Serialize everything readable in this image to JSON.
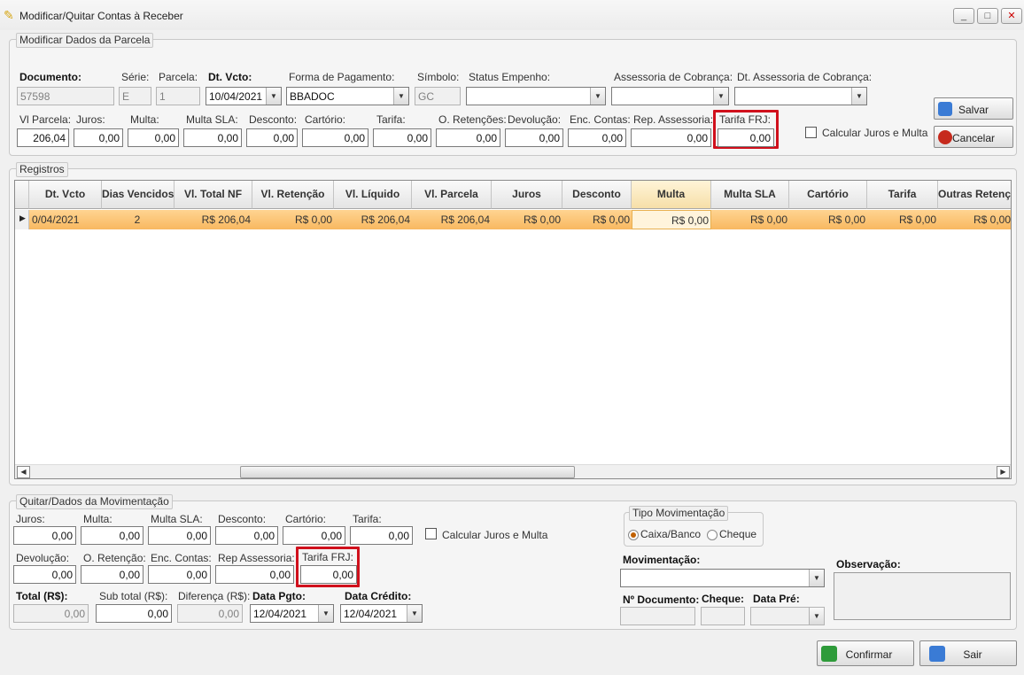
{
  "window": {
    "title": "Modificar/Quitar Contas à Receber",
    "min": "_",
    "max": "□",
    "close": "✕"
  },
  "parcela": {
    "legend": "Modificar Dados da Parcela",
    "documento_label": "Documento:",
    "documento": "57598",
    "serie_label": "Série:",
    "serie": "E",
    "parcela_label": "Parcela:",
    "parcela": "1",
    "dtvcto_label": "Dt. Vcto:",
    "dtvcto": "10/04/2021",
    "forma_label": "Forma de Pagamento:",
    "forma": "BBADOC",
    "simbolo_label": "Símbolo:",
    "simbolo": "GC",
    "status_label": "Status Empenho:",
    "status": "",
    "assessoria_label": "Assessoria de Cobrança:",
    "assessoria": "",
    "dtassessoria_label": "Dt. Assessoria de Cobrança:",
    "dtassessoria": "",
    "vlparcela_label": "Vl Parcela:",
    "vlparcela": "206,04",
    "juros_label": "Juros:",
    "juros": "0,00",
    "multa_label": "Multa:",
    "multa": "0,00",
    "multasla_label": "Multa SLA:",
    "multasla": "0,00",
    "desconto_label": "Desconto:",
    "desconto": "0,00",
    "cartorio_label": "Cartório:",
    "cartorio": "0,00",
    "tarifa_label": "Tarifa:",
    "tarifa": "0,00",
    "oret_label": "O. Retenções:",
    "oret": "0,00",
    "devolucao_label": "Devolução:",
    "devolucao": "0,00",
    "enc_label": "Enc. Contas:",
    "enc": "0,00",
    "rep_label": "Rep. Assessoria:",
    "rep": "0,00",
    "frj_label": "Tarifa FRJ:",
    "frj": "0,00",
    "calc_label": "Calcular Juros e Multa",
    "salvar": "Salvar",
    "cancelar": "Cancelar"
  },
  "registros": {
    "legend": "Registros",
    "columns": [
      "Dt. Vcto",
      "Dias Vencidos",
      "Vl. Total NF",
      "Vl. Retenção",
      "Vl. Líquido",
      "Vl. Parcela",
      "Juros",
      "Desconto",
      "Multa",
      "Multa SLA",
      "Cartório",
      "Tarifa",
      "Outras Retençõ..."
    ],
    "row": [
      "0/04/2021",
      "2",
      "R$ 206,04",
      "R$ 0,00",
      "R$ 206,04",
      "R$ 206,04",
      "R$ 0,00",
      "R$ 0,00",
      "R$ 0,00",
      "R$ 0,00",
      "R$ 0,00",
      "R$ 0,00",
      "R$ 0,00"
    ]
  },
  "quitar": {
    "legend": "Quitar/Dados da Movimentação",
    "juros_label": "Juros:",
    "juros": "0,00",
    "multa_label": "Multa:",
    "multa": "0,00",
    "multasla_label": "Multa SLA:",
    "multasla": "0,00",
    "desconto_label": "Desconto:",
    "desconto": "0,00",
    "cartorio_label": "Cartório:",
    "cartorio": "0,00",
    "tarifa_label": "Tarifa:",
    "tarifa": "0,00",
    "calc_label": "Calcular Juros e Multa",
    "devolucao_label": "Devolução:",
    "devolucao": "0,00",
    "oret_label": "O. Retenção:",
    "oret": "0,00",
    "enc_label": "Enc. Contas:",
    "enc": "0,00",
    "rep_label": "Rep Assessoria:",
    "rep": "0,00",
    "frj_label": "Tarifa FRJ:",
    "frj": "0,00",
    "total_label": "Total (R$):",
    "total": "0,00",
    "subtotal_label": "Sub total (R$):",
    "subtotal": "0,00",
    "diferenca_label": "Diferença (R$):",
    "diferenca": "0,00",
    "datapgto_label": "Data Pgto:",
    "datapgto": "12/04/2021",
    "datacredito_label": "Data Crédito:",
    "datacredito": "12/04/2021",
    "tipo_legend": "Tipo Movimentação",
    "caixa_label": "Caixa/Banco",
    "cheque_label": "Cheque",
    "movimentacao_label": "Movimentação:",
    "movimentacao": "",
    "ndoc_label": "Nº Documento:",
    "ndoc": "",
    "cheque_field_label": "Cheque:",
    "cheque": "",
    "datapre_label": "Data Pré:",
    "datapre": "",
    "observacao_label": "Observação:"
  },
  "footer": {
    "confirmar": "Confirmar",
    "sair": "Sair"
  }
}
